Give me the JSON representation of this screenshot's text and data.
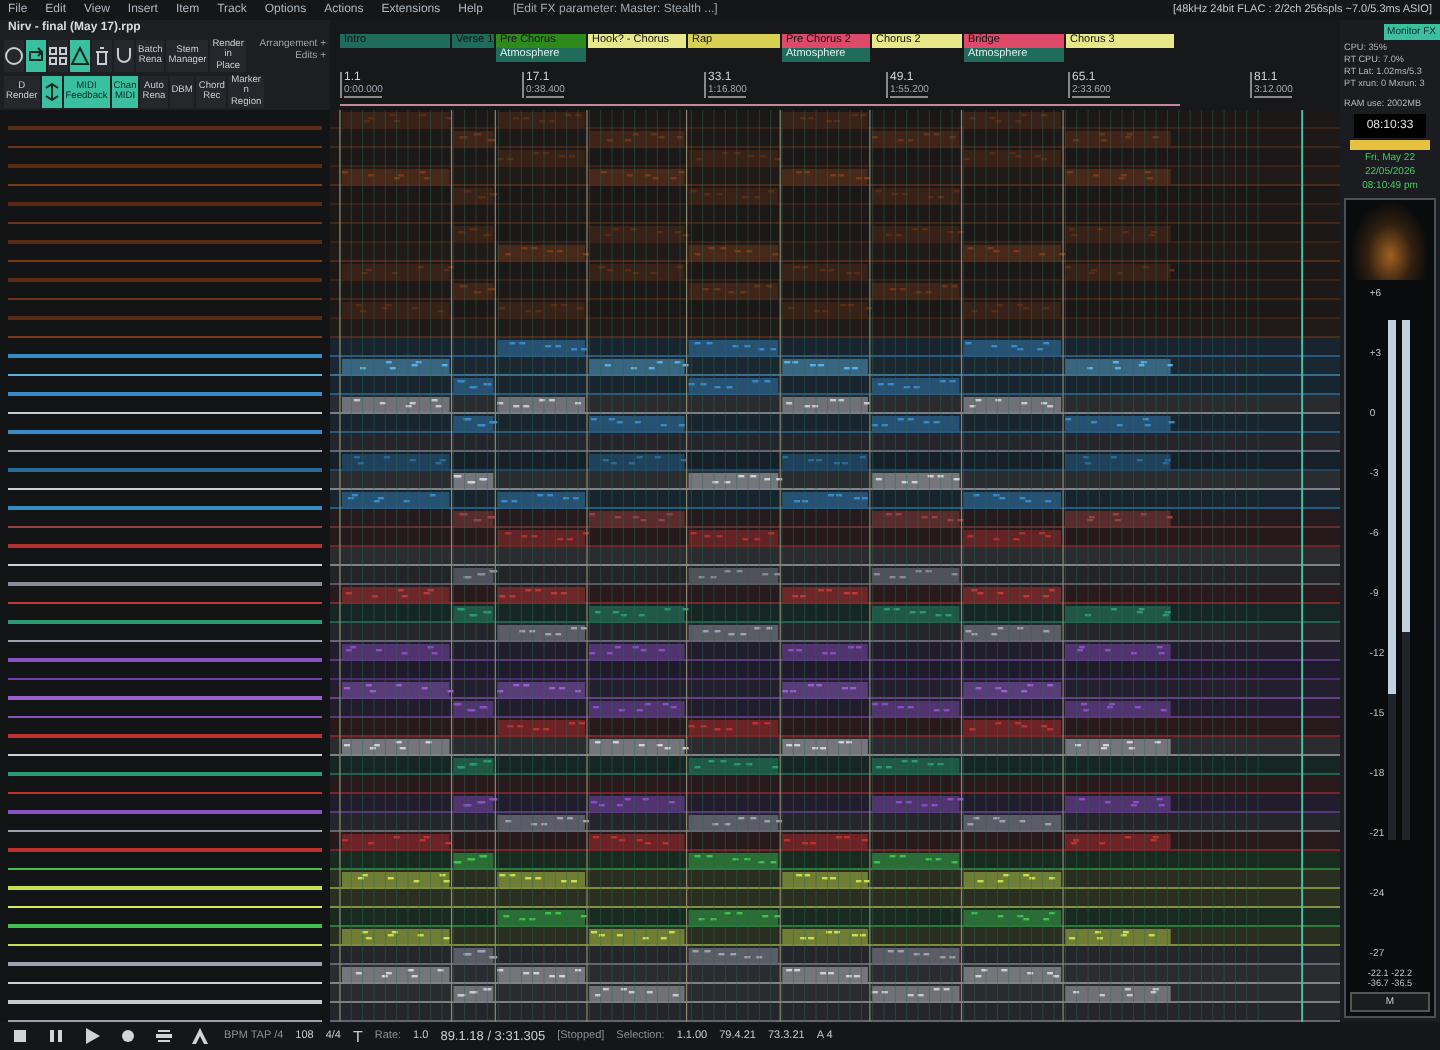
{
  "menu": [
    "File",
    "Edit",
    "View",
    "Insert",
    "Item",
    "Track",
    "Options",
    "Actions",
    "Extensions",
    "Help"
  ],
  "menu_status": "[Edit FX parameter: Master: Stealth ...]",
  "audio_status": "[48kHz 24bit FLAC : 2/2ch 256spls ~7.0/5.3ms ASIO]",
  "project_title": "Nirv - final (May 17).rpp",
  "toolbar_rows": [
    [
      {
        "kind": "icon",
        "on": false
      },
      {
        "kind": "icon",
        "on": true
      },
      {
        "kind": "icon",
        "on": false
      },
      {
        "kind": "icon",
        "on": true
      },
      {
        "kind": "icon",
        "on": false
      },
      {
        "kind": "icon",
        "on": false
      },
      {
        "kind": "text",
        "label": "Batch Rena",
        "on": false
      },
      {
        "kind": "text",
        "label": "Stem Manager",
        "on": false
      },
      {
        "kind": "text",
        "label": "Render in Place",
        "on": false
      }
    ],
    [
      {
        "kind": "text",
        "label": "D Render",
        "on": false
      },
      {
        "kind": "icon",
        "on": true
      },
      {
        "kind": "text",
        "label": "MIDI Feedback",
        "on": true
      },
      {
        "kind": "text",
        "label": "Chan MIDI",
        "on": true
      },
      {
        "kind": "text",
        "label": "Auto Rena",
        "on": false
      },
      {
        "kind": "text",
        "label": "DBM",
        "on": false
      },
      {
        "kind": "text",
        "label": "Chord Rec",
        "on": false
      },
      {
        "kind": "text",
        "label": "Marker n Region",
        "on": false
      }
    ]
  ],
  "ruler_labels": [
    "Arrangement +",
    "Edits +"
  ],
  "regions": [
    {
      "name": "Intro",
      "color": "#1f6b5c"
    },
    {
      "name": "Verse 1",
      "color": "#1f6b5c"
    },
    {
      "name": "Pre Chorus",
      "color": "#2f8a1c",
      "sublabel": "Atmosphere"
    },
    {
      "name": "Hook? - Chorus",
      "color": "#e8e88a"
    },
    {
      "name": "Rap",
      "color": "#d8d050"
    },
    {
      "name": "Pre Chorus 2",
      "color": "#e04a6a",
      "sublabel": "Atmosphere"
    },
    {
      "name": "Chorus 2",
      "color": "#e8e88a"
    },
    {
      "name": "Bridge",
      "color": "#e04a6a",
      "sublabel": "Atmosphere"
    },
    {
      "name": "Chorus 3",
      "color": "#e8e88a"
    }
  ],
  "markers": [
    {
      "bar": "1.1",
      "time": "0:00.000"
    },
    {
      "bar": "17.1",
      "time": "0:38.400"
    },
    {
      "bar": "33.1",
      "time": "1:16.800"
    },
    {
      "bar": "49.1",
      "time": "1:55.200"
    },
    {
      "bar": "65.1",
      "time": "2:33.600"
    },
    {
      "bar": "81.1",
      "time": "3:12.000"
    }
  ],
  "tracks": [
    {
      "color": "#5a2c14"
    },
    {
      "color": "#6a3418"
    },
    {
      "color": "#5a2c14"
    },
    {
      "color": "#7a3a18"
    },
    {
      "color": "#5a2c14"
    },
    {
      "color": "#6a3418"
    },
    {
      "color": "#5a2c14"
    },
    {
      "color": "#7a3a18"
    },
    {
      "color": "#5a2c14"
    },
    {
      "color": "#6a3418"
    },
    {
      "color": "#5a2c14"
    },
    {
      "color": "#7a3a18"
    },
    {
      "color": "#3a8ac8"
    },
    {
      "color": "#5ab0e0"
    },
    {
      "color": "#3a8ac8"
    },
    {
      "color": "#c8c8d0"
    },
    {
      "color": "#3a8ac8"
    },
    {
      "color": "#a0a0b0"
    },
    {
      "color": "#2a6a9a"
    },
    {
      "color": "#d0d0d8"
    },
    {
      "color": "#3a8ac8"
    },
    {
      "color": "#9a4040"
    },
    {
      "color": "#b03030"
    },
    {
      "color": "#d0d0d8"
    },
    {
      "color": "#8a8a98"
    },
    {
      "color": "#c03838"
    },
    {
      "color": "#2a9a70"
    },
    {
      "color": "#a0a0b0"
    },
    {
      "color": "#8a50c0"
    },
    {
      "color": "#7040b0"
    },
    {
      "color": "#9a60d0"
    },
    {
      "color": "#8a50c0"
    },
    {
      "color": "#c03030"
    },
    {
      "color": "#d0d0d8"
    },
    {
      "color": "#2a9a70"
    },
    {
      "color": "#c03030"
    },
    {
      "color": "#8a50c0"
    },
    {
      "color": "#a0a0b0"
    },
    {
      "color": "#c03030"
    },
    {
      "color": "#40c050"
    },
    {
      "color": "#c8e050"
    },
    {
      "color": "#d8e860"
    },
    {
      "color": "#40c050"
    },
    {
      "color": "#c8e050"
    },
    {
      "color": "#a0a0b0"
    },
    {
      "color": "#d0d0d8"
    },
    {
      "color": "#c8c8d0"
    },
    {
      "color": "#a0a0b0"
    }
  ],
  "monitor_fx": {
    "label": "Monitor FX",
    "on": true
  },
  "performance": [
    "CPU: 35%",
    "RT CPU: 7.0%",
    "RT Lat: 1.02ms/5.3",
    "PT xrun: 0 Mxrun: 3"
  ],
  "ram": "RAM use: 2002MB",
  "clock": "08:10:33",
  "date": [
    "Fri, May 22",
    "22/05/2026",
    "08:10:49 pm"
  ],
  "meter": {
    "scale": [
      "+6",
      "+3",
      "0",
      "-3",
      "-6",
      "-9",
      "-12",
      "-15",
      "-18",
      "-21",
      "-24",
      "-27"
    ],
    "channels": [
      {
        "level": 0.72
      },
      {
        "level": 0.6
      }
    ],
    "readouts": [
      "-22.1 -22.2",
      "-36.7 -36.5"
    ],
    "mute": "M"
  },
  "transport": {
    "buttons": [
      {
        "on": false
      },
      {
        "on": false
      },
      {
        "on": false
      },
      {
        "on": false
      },
      {
        "on": false
      },
      {
        "on": false
      }
    ],
    "tempo_label": "BPM TAP /4",
    "bpm": "108",
    "signature": "4/4",
    "tempo_glyph": "T",
    "rate_label": "Rate:",
    "rate": "1.0",
    "position": "89.1.18 / 3:31.305",
    "state": "[Stopped]",
    "selection_label": "Selection:",
    "selection": [
      "1.1.00",
      "79.4.21",
      "73.3.21"
    ],
    "pitch": "A 4"
  }
}
